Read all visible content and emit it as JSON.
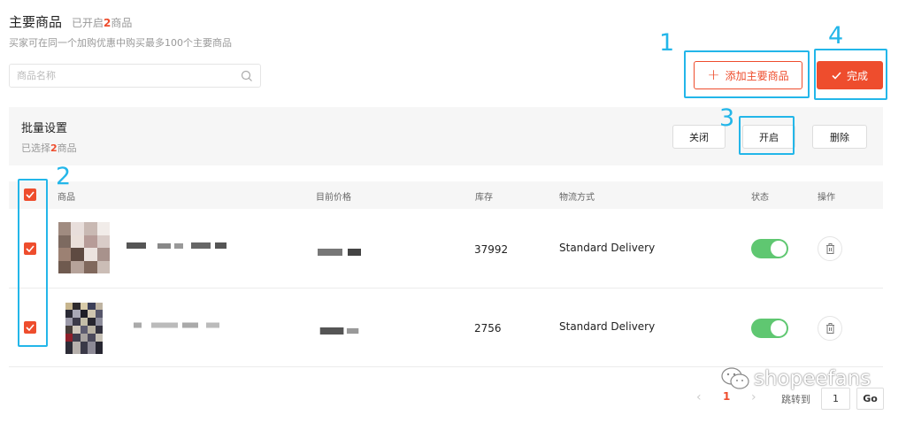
{
  "header": {
    "title": "主要商品",
    "status_prefix": "已开启",
    "status_count": "2",
    "status_suffix": "商品",
    "subtitle": "买家可在同一个加购优惠中购买最多100个主要商品"
  },
  "search": {
    "placeholder": "商品名称",
    "icon": "search-icon"
  },
  "actions": {
    "add_label": "添加主要商品",
    "done_label": "完成"
  },
  "callouts": [
    "1",
    "2",
    "3",
    "4"
  ],
  "bulk": {
    "title": "批量设置",
    "selected_prefix": "已选择",
    "selected_count": "2",
    "selected_suffix": "商品",
    "close_label": "关闭",
    "enable_label": "开启",
    "delete_label": "删除"
  },
  "table": {
    "headers": [
      "商品",
      "目前价格",
      "库存",
      "物流方式",
      "状态",
      "操作"
    ],
    "rows": [
      {
        "stock": "37992",
        "shipping": "Standard Delivery",
        "status_on": true,
        "selected": true
      },
      {
        "stock": "2756",
        "shipping": "Standard Delivery",
        "status_on": true,
        "selected": true
      }
    ]
  },
  "pagination": {
    "current_page": "1",
    "goto_label": "跳转到",
    "goto_value": "1",
    "go_label": "Go"
  },
  "watermark": "shopeefans",
  "colors": {
    "accent": "#ee4d2d",
    "callout": "#23b6e9",
    "toggle_on": "#5fc771"
  }
}
